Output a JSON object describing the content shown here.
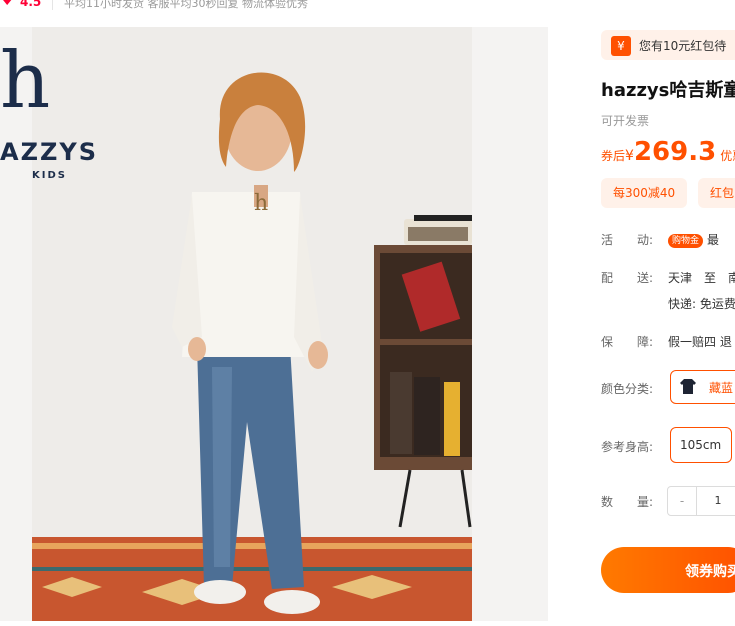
{
  "rating": {
    "score": "4.5",
    "stats": "平均11小时发货   客服平均30秒回复   物流体验优秀"
  },
  "brand_logo": {
    "glyph": "h",
    "name": "AZZYS",
    "sub": "KIDS"
  },
  "coupon_banner": {
    "text": "您有10元红包待",
    "icon": "¥"
  },
  "product": {
    "title": "hazzys哈吉斯童",
    "invoice": "可开发票",
    "price_label": "券后",
    "currency": "¥",
    "price": "269.3",
    "price_suffix": "优惠"
  },
  "promos": [
    "每300减40",
    "红包"
  ],
  "activity": {
    "label": "活　　动:",
    "badge": "购物金",
    "text": "最"
  },
  "shipping": {
    "label": "配　　送:",
    "route": "天津　至　南",
    "method": "快递: 免运费"
  },
  "guarantee": {
    "label": "保　　障:",
    "text": "假一赔四 退"
  },
  "color": {
    "label": "颜色分类:",
    "selected": "藏蓝"
  },
  "size": {
    "label": "参考身高:",
    "selected": "105cm"
  },
  "quantity": {
    "label": "数　　量:",
    "minus": "-",
    "value": "1"
  },
  "buy_button": "领券购买",
  "colors": {
    "accent": "#ff5000",
    "brand_navy": "#1c2d4a",
    "rating_red": "#ff0036"
  }
}
